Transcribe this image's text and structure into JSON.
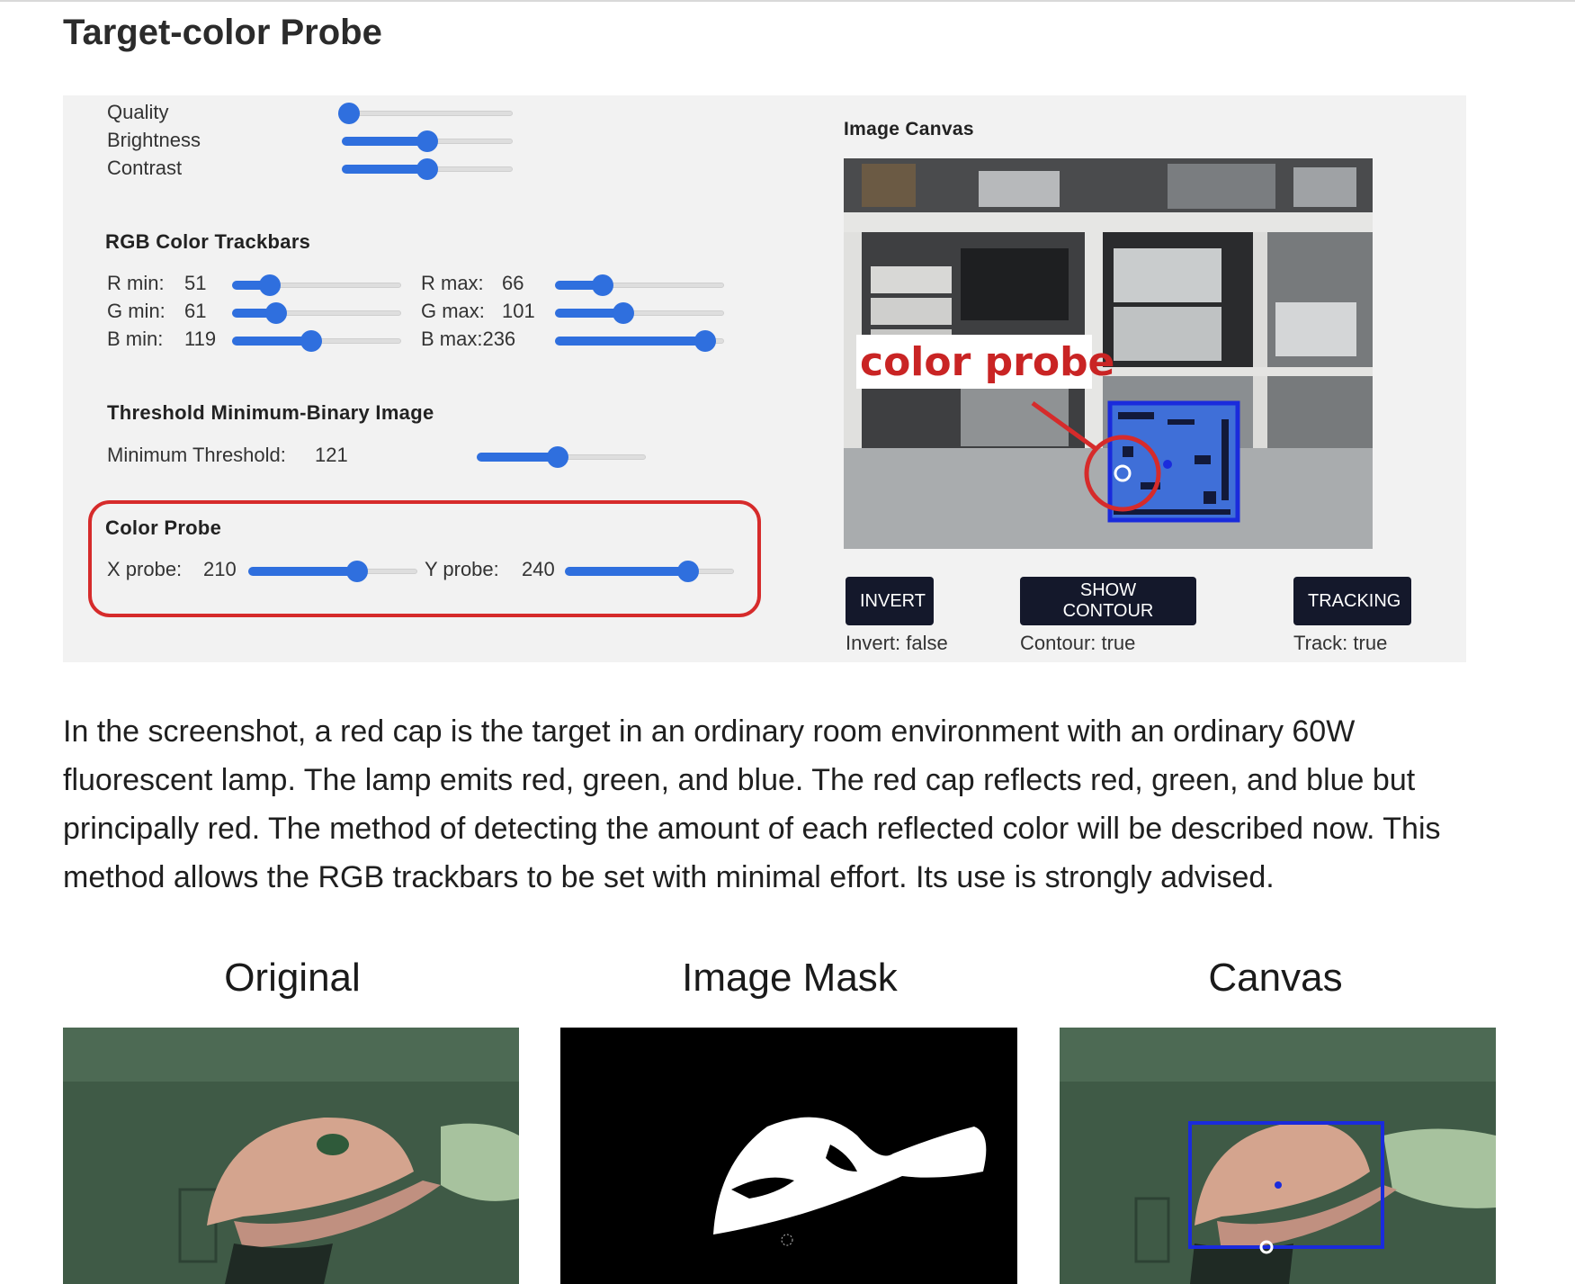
{
  "page": {
    "title": "Target-color Probe"
  },
  "panel": {
    "camera": {
      "quality_label": "Quality",
      "quality_level": 0.0,
      "brightness_label": "Brightness",
      "brightness_level": 0.5,
      "contrast_label": "Contrast",
      "contrast_level": 0.5
    },
    "rgb": {
      "title": "RGB Color Trackbars",
      "r_min_label": "R min:",
      "r_min_value": "51",
      "g_min_label": "G min:",
      "g_min_value": "61",
      "b_min_label": "B min:",
      "b_min_value": "119",
      "r_max_label": "R max:",
      "r_max_value": "66",
      "g_max_label": "G max:",
      "g_max_value": "101",
      "b_max_label": "B max:236"
    },
    "threshold": {
      "title": "Threshold Minimum-Binary Image",
      "label": "Minimum Threshold:",
      "value": "121"
    },
    "probe": {
      "title": "Color Probe",
      "x_label": "X probe:",
      "x_value": "210",
      "y_label": "Y probe:",
      "y_value": "240"
    },
    "canvas": {
      "title": "Image Canvas",
      "annotation": "color probe"
    },
    "buttons": {
      "invert_label": "INVERT",
      "invert_status": "Invert: false",
      "contour_label": "SHOW CONTOUR",
      "contour_status": "Contour: true",
      "tracking_label": "TRACKING",
      "tracking_status": "Track: true"
    }
  },
  "paragraph": "In the screenshot, a red cap is the target in an ordinary room environment with an ordinary 60W fluorescent lamp. The lamp emits red, green, and blue. The red cap reflects red, green, and blue but principally red. The method of detecting the amount of each reflected color will be described now. This method allows the RGB trackbars to be set with minimal effort. Its use is strongly advised.",
  "figures": {
    "original_title": "Original",
    "mask_title": "Image Mask",
    "canvas_title": "Canvas"
  },
  "colors": {
    "slider_blue": "#2f6fde",
    "button_navy": "#14182b",
    "highlight_red": "#d62b2b",
    "contour_blue": "#1a2bdc"
  }
}
